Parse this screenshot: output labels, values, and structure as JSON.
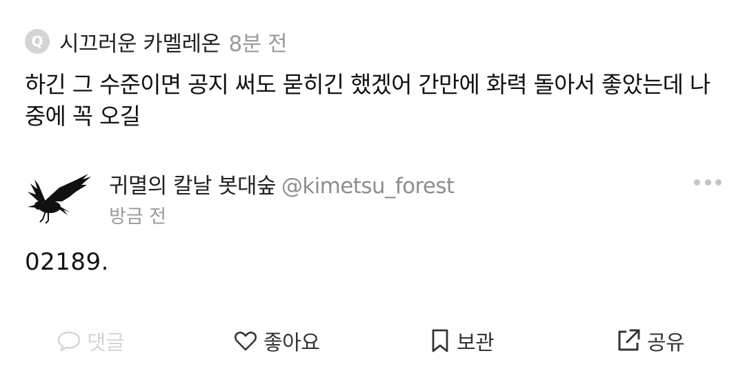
{
  "quoted": {
    "badge": "Q",
    "author": "시끄러운 카멜레온",
    "time": "8분 전",
    "text": "하긴 그 수준이면 공지 써도 묻히긴 했겠어 간만에 화력 돌아서 좋았는데 나중에 꼭 오길"
  },
  "post": {
    "author_name": "귀멸의 칼날 봇대숲",
    "handle": "@kimetsu_forest",
    "time": "방금 전",
    "text": "02189.",
    "avatar_icon": "crow-icon",
    "more_icon": "more-dots-icon"
  },
  "actions": {
    "reply": {
      "label": "댓글",
      "icon": "comment-bubble-icon",
      "enabled": false
    },
    "like": {
      "label": "좋아요",
      "icon": "heart-icon"
    },
    "save": {
      "label": "보관",
      "icon": "bookmark-icon"
    },
    "share": {
      "label": "공유",
      "icon": "share-external-icon"
    }
  },
  "colors": {
    "text_primary": "#111111",
    "text_muted": "#9a9a9a",
    "disabled": "#d5d5d5",
    "badge": "#d4d4d4"
  }
}
